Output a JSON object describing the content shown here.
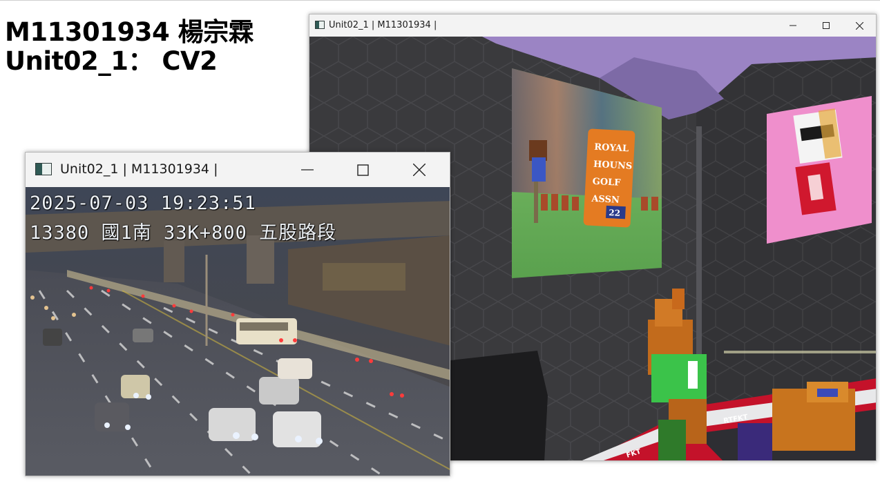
{
  "slide": {
    "title_line1": "M11301934 楊宗霖",
    "title_line2": "Unit02_1： CV2"
  },
  "windows": {
    "vr": {
      "title": "Unit02_1 | M11301934 |",
      "icon": "opencv-window-icon",
      "scene": {
        "poster_words": [
          "OYAL",
          "OUNS",
          "OLF",
          "SSN"
        ],
        "poster_initials": [
          "R",
          "H",
          "G",
          "A"
        ],
        "poster_badge": "22",
        "rail_text": "RTFKT",
        "rail_text_left": "FKT"
      }
    },
    "cctv": {
      "title": "Unit02_1 | M11301934 |",
      "icon": "opencv-window-icon",
      "overlay": {
        "timestamp": "2025-07-03  19:23:51",
        "location": "13380  國1南  33K+800  五股路段"
      }
    }
  },
  "colors": {
    "titlebar": "#f3f3f3",
    "wall": "#3a3a3d",
    "ceiling": "#9b84c4",
    "pink_panel": "#ef8fcc",
    "rail_red": "#c4122a",
    "poster_orange": "#e47b22"
  }
}
